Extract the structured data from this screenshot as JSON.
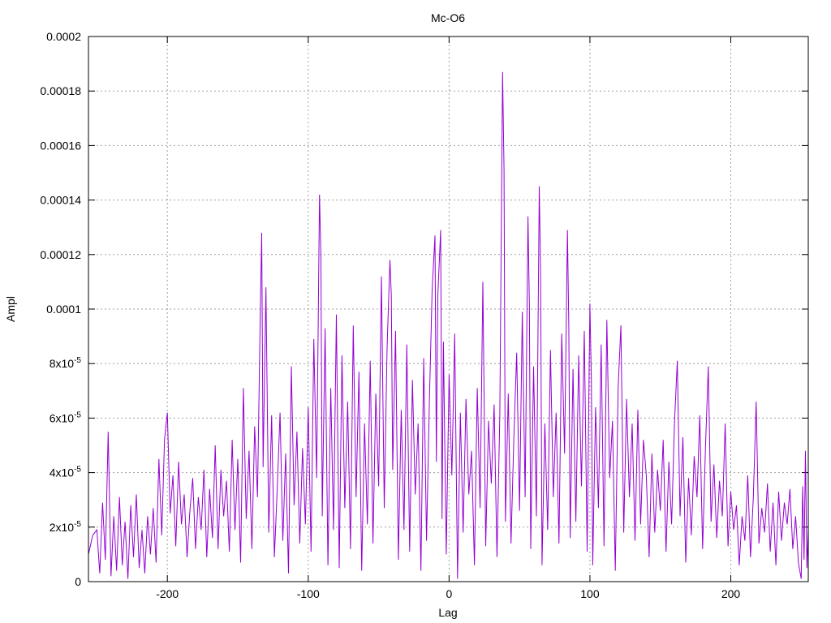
{
  "chart_data": {
    "type": "line",
    "title": "Mc-O6",
    "xlabel": "Lag",
    "ylabel": "Ampl",
    "xlim": [
      -256,
      255
    ],
    "ylim": [
      0,
      0.0002
    ],
    "grid": true,
    "legend": "none",
    "x_ticks": [
      {
        "value": -200,
        "label": "-200"
      },
      {
        "value": -100,
        "label": "-100"
      },
      {
        "value": 0,
        "label": "0"
      },
      {
        "value": 100,
        "label": "100"
      },
      {
        "value": 200,
        "label": "200"
      }
    ],
    "y_ticks": [
      {
        "value": 0,
        "label": "0"
      },
      {
        "value": 2e-05,
        "label": "2x10",
        "exp": "-5"
      },
      {
        "value": 4e-05,
        "label": "4x10",
        "exp": "-5"
      },
      {
        "value": 6e-05,
        "label": "6x10",
        "exp": "-5"
      },
      {
        "value": 8e-05,
        "label": "8x10",
        "exp": "-5"
      },
      {
        "value": 0.0001,
        "label": "0.0001"
      },
      {
        "value": 0.00012,
        "label": "0.00012"
      },
      {
        "value": 0.00014,
        "label": "0.00014"
      },
      {
        "value": 0.00016,
        "label": "0.00016"
      },
      {
        "value": 0.00018,
        "label": "0.00018"
      },
      {
        "value": 0.0002,
        "label": "0.0002"
      }
    ],
    "series": [
      {
        "color": "#9400d3",
        "points": [
          [
            -256,
            1e-05
          ],
          [
            -253,
            1.7e-05
          ],
          [
            -250,
            1.9e-05
          ],
          [
            -248,
            3e-06
          ],
          [
            -246,
            2.9e-05
          ],
          [
            -244,
            8e-06
          ],
          [
            -242,
            5.5e-05
          ],
          [
            -240,
            2e-06
          ],
          [
            -238,
            2.4e-05
          ],
          [
            -236,
            4e-06
          ],
          [
            -234,
            3.1e-05
          ],
          [
            -232,
            6e-06
          ],
          [
            -230,
            2.2e-05
          ],
          [
            -228,
            1e-06
          ],
          [
            -226,
            2.8e-05
          ],
          [
            -224,
            9e-06
          ],
          [
            -222,
            3.2e-05
          ],
          [
            -220,
            5e-06
          ],
          [
            -218,
            1.9e-05
          ],
          [
            -216,
            3e-06
          ],
          [
            -214,
            2.4e-05
          ],
          [
            -212,
            1e-05
          ],
          [
            -210,
            2.7e-05
          ],
          [
            -208,
            7e-06
          ],
          [
            -206,
            4.5e-05
          ],
          [
            -204,
            1.7e-05
          ],
          [
            -202,
            5.2e-05
          ],
          [
            -200,
            6.2e-05
          ],
          [
            -198,
            2.5e-05
          ],
          [
            -196,
            3.9e-05
          ],
          [
            -194,
            1.3e-05
          ],
          [
            -192,
            4.4e-05
          ],
          [
            -190,
            2.1e-05
          ],
          [
            -188,
            3.2e-05
          ],
          [
            -186,
            9e-06
          ],
          [
            -184,
            2.6e-05
          ],
          [
            -182,
            3.8e-05
          ],
          [
            -180,
            1.2e-05
          ],
          [
            -178,
            3.1e-05
          ],
          [
            -176,
            1.9e-05
          ],
          [
            -174,
            4.1e-05
          ],
          [
            -172,
            9e-06
          ],
          [
            -170,
            3.4e-05
          ],
          [
            -168,
            1.6e-05
          ],
          [
            -166,
            5e-05
          ],
          [
            -164,
            1.2e-05
          ],
          [
            -162,
            4.1e-05
          ],
          [
            -160,
            2.4e-05
          ],
          [
            -158,
            3.7e-05
          ],
          [
            -156,
            1.1e-05
          ],
          [
            -154,
            5.2e-05
          ],
          [
            -152,
            1.9e-05
          ],
          [
            -150,
            4.5e-05
          ],
          [
            -148,
            7e-06
          ],
          [
            -146,
            7.1e-05
          ],
          [
            -144,
            2.3e-05
          ],
          [
            -142,
            4.8e-05
          ],
          [
            -140,
            1.2e-05
          ],
          [
            -138,
            5.7e-05
          ],
          [
            -136,
            3.1e-05
          ],
          [
            -134,
            0.0001
          ],
          [
            -133,
            0.000128
          ],
          [
            -132,
            4.2e-05
          ],
          [
            -130,
            0.000108
          ],
          [
            -128,
            1.8e-05
          ],
          [
            -126,
            6.1e-05
          ],
          [
            -124,
            9e-06
          ],
          [
            -122,
            3.4e-05
          ],
          [
            -120,
            6.2e-05
          ],
          [
            -118,
            1.5e-05
          ],
          [
            -116,
            4.7e-05
          ],
          [
            -114,
            3e-06
          ],
          [
            -112,
            7.9e-05
          ],
          [
            -110,
            2.8e-05
          ],
          [
            -108,
            5.5e-05
          ],
          [
            -106,
            1.4e-05
          ],
          [
            -104,
            4.9e-05
          ],
          [
            -102,
            2.1e-05
          ],
          [
            -100,
            6.4e-05
          ],
          [
            -98,
            1.1e-05
          ],
          [
            -96,
            8.9e-05
          ],
          [
            -94,
            3.8e-05
          ],
          [
            -92,
            0.000142
          ],
          [
            -91,
            0.00012
          ],
          [
            -90,
            2.4e-05
          ],
          [
            -88,
            9.3e-05
          ],
          [
            -86,
            6e-06
          ],
          [
            -84,
            7.1e-05
          ],
          [
            -82,
            1.9e-05
          ],
          [
            -80,
            9.8e-05
          ],
          [
            -78,
            5e-06
          ],
          [
            -76,
            8.3e-05
          ],
          [
            -74,
            2.7e-05
          ],
          [
            -72,
            6.6e-05
          ],
          [
            -70,
            1.2e-05
          ],
          [
            -68,
            9.4e-05
          ],
          [
            -66,
            3.1e-05
          ],
          [
            -64,
            7.7e-05
          ],
          [
            -62,
            4e-06
          ],
          [
            -60,
            5.8e-05
          ],
          [
            -58,
            2.1e-05
          ],
          [
            -56,
            8.1e-05
          ],
          [
            -54,
            1.4e-05
          ],
          [
            -52,
            6.9e-05
          ],
          [
            -50,
            3.5e-05
          ],
          [
            -48,
            0.000112
          ],
          [
            -46,
            2.7e-05
          ],
          [
            -44,
            8.6e-05
          ],
          [
            -42,
            0.000118
          ],
          [
            -41,
            0.000105
          ],
          [
            -40,
            4.1e-05
          ],
          [
            -38,
            9.2e-05
          ],
          [
            -36,
            8e-06
          ],
          [
            -34,
            6.3e-05
          ],
          [
            -32,
            1.9e-05
          ],
          [
            -30,
            8.7e-05
          ],
          [
            -28,
            1.1e-05
          ],
          [
            -26,
            7.4e-05
          ],
          [
            -24,
            3.2e-05
          ],
          [
            -22,
            5.8e-05
          ],
          [
            -20,
            4e-06
          ],
          [
            -18,
            8.2e-05
          ],
          [
            -16,
            1.5e-05
          ],
          [
            -14,
            6.6e-05
          ],
          [
            -12,
            0.000107
          ],
          [
            -10,
            0.000127
          ],
          [
            -9,
            4.4e-05
          ],
          [
            -8,
            0.000105
          ],
          [
            -6,
            0.000129
          ],
          [
            -5,
            2.3e-05
          ],
          [
            -4,
            8.8e-05
          ],
          [
            -2,
            1e-05
          ],
          [
            0,
            7.6e-05
          ],
          [
            2,
            3.9e-05
          ],
          [
            4,
            9.1e-05
          ],
          [
            6,
            1e-06
          ],
          [
            8,
            6.2e-05
          ],
          [
            10,
            1.8e-05
          ],
          [
            12,
            6.7e-05
          ],
          [
            14,
            3.2e-05
          ],
          [
            16,
            4.8e-05
          ],
          [
            18,
            6e-06
          ],
          [
            20,
            7.1e-05
          ],
          [
            22,
            2.7e-05
          ],
          [
            24,
            0.00011
          ],
          [
            26,
            1.3e-05
          ],
          [
            28,
            5.9e-05
          ],
          [
            30,
            3.6e-05
          ],
          [
            32,
            6.5e-05
          ],
          [
            34,
            9e-06
          ],
          [
            36,
            6.1e-05
          ],
          [
            38,
            0.000187
          ],
          [
            39,
            0.000151
          ],
          [
            40,
            2.2e-05
          ],
          [
            42,
            6.9e-05
          ],
          [
            44,
            1.4e-05
          ],
          [
            46,
            5.3e-05
          ],
          [
            48,
            8.4e-05
          ],
          [
            50,
            2.6e-05
          ],
          [
            52,
            9.9e-05
          ],
          [
            54,
            3.1e-05
          ],
          [
            56,
            0.000134
          ],
          [
            57,
            0.000102
          ],
          [
            58,
            1.2e-05
          ],
          [
            60,
            7.9e-05
          ],
          [
            62,
            2.4e-05
          ],
          [
            64,
            0.000145
          ],
          [
            65,
            0.000112
          ],
          [
            66,
            6e-06
          ],
          [
            68,
            5.8e-05
          ],
          [
            70,
            1.9e-05
          ],
          [
            72,
            8.5e-05
          ],
          [
            74,
            3.1e-05
          ],
          [
            76,
            6.2e-05
          ],
          [
            78,
            1.4e-05
          ],
          [
            80,
            9.1e-05
          ],
          [
            82,
            4.7e-05
          ],
          [
            84,
            0.000129
          ],
          [
            85,
            9.4e-05
          ],
          [
            86,
            1.6e-05
          ],
          [
            88,
            7.8e-05
          ],
          [
            90,
            2.2e-05
          ],
          [
            92,
            8.3e-05
          ],
          [
            94,
            3.5e-05
          ],
          [
            96,
            9.2e-05
          ],
          [
            98,
            1.1e-05
          ],
          [
            100,
            0.000102
          ],
          [
            101,
            7.4e-05
          ],
          [
            102,
            6e-06
          ],
          [
            104,
            6.4e-05
          ],
          [
            106,
            2.7e-05
          ],
          [
            108,
            8.7e-05
          ],
          [
            110,
            1.3e-05
          ],
          [
            112,
            9.6e-05
          ],
          [
            114,
            3.8e-05
          ],
          [
            116,
            5.9e-05
          ],
          [
            118,
            4e-06
          ],
          [
            120,
            7.1e-05
          ],
          [
            122,
            9.4e-05
          ],
          [
            124,
            1.8e-05
          ],
          [
            126,
            6.7e-05
          ],
          [
            128,
            3.1e-05
          ],
          [
            130,
            5.8e-05
          ],
          [
            132,
            1.5e-05
          ],
          [
            134,
            6.3e-05
          ],
          [
            136,
            2.1e-05
          ],
          [
            138,
            5.2e-05
          ],
          [
            140,
            3.9e-05
          ],
          [
            142,
            9e-06
          ],
          [
            144,
            4.7e-05
          ],
          [
            146,
            1.8e-05
          ],
          [
            148,
            4.1e-05
          ],
          [
            150,
            2.6e-05
          ],
          [
            152,
            5.2e-05
          ],
          [
            154,
            1.1e-05
          ],
          [
            156,
            4.4e-05
          ],
          [
            158,
            2.1e-05
          ],
          [
            160,
            5.8e-05
          ],
          [
            162,
            8.1e-05
          ],
          [
            164,
            2.4e-05
          ],
          [
            166,
            5.3e-05
          ],
          [
            168,
            7e-06
          ],
          [
            170,
            3.8e-05
          ],
          [
            172,
            1.7e-05
          ],
          [
            174,
            4.6e-05
          ],
          [
            176,
            3.1e-05
          ],
          [
            178,
            6.1e-05
          ],
          [
            180,
            1.2e-05
          ],
          [
            182,
            4.9e-05
          ],
          [
            184,
            7.9e-05
          ],
          [
            186,
            2.2e-05
          ],
          [
            188,
            4.3e-05
          ],
          [
            190,
            1.6e-05
          ],
          [
            192,
            3.7e-05
          ],
          [
            194,
            2.4e-05
          ],
          [
            196,
            5.8e-05
          ],
          [
            198,
            1.3e-05
          ],
          [
            200,
            3.3e-05
          ],
          [
            202,
            1.9e-05
          ],
          [
            204,
            2.8e-05
          ],
          [
            206,
            6e-06
          ],
          [
            208,
            2.4e-05
          ],
          [
            210,
            1.5e-05
          ],
          [
            212,
            3.9e-05
          ],
          [
            214,
            9e-06
          ],
          [
            216,
            3.1e-05
          ],
          [
            218,
            6.6e-05
          ],
          [
            220,
            1.4e-05
          ],
          [
            222,
            2.7e-05
          ],
          [
            224,
            1.8e-05
          ],
          [
            226,
            3.6e-05
          ],
          [
            228,
            1.1e-05
          ],
          [
            230,
            2.9e-05
          ],
          [
            232,
            6e-06
          ],
          [
            234,
            3.3e-05
          ],
          [
            236,
            1.5e-05
          ],
          [
            238,
            2.9e-05
          ],
          [
            240,
            2.1e-05
          ],
          [
            242,
            3.4e-05
          ],
          [
            244,
            1.2e-05
          ],
          [
            246,
            2.4e-05
          ],
          [
            248,
            7e-06
          ],
          [
            250,
            1e-06
          ],
          [
            251,
            3.5e-05
          ],
          [
            252,
            8e-06
          ],
          [
            253,
            4.8e-05
          ],
          [
            254,
            5e-06
          ],
          [
            255,
            1.9e-05
          ]
        ]
      }
    ]
  }
}
